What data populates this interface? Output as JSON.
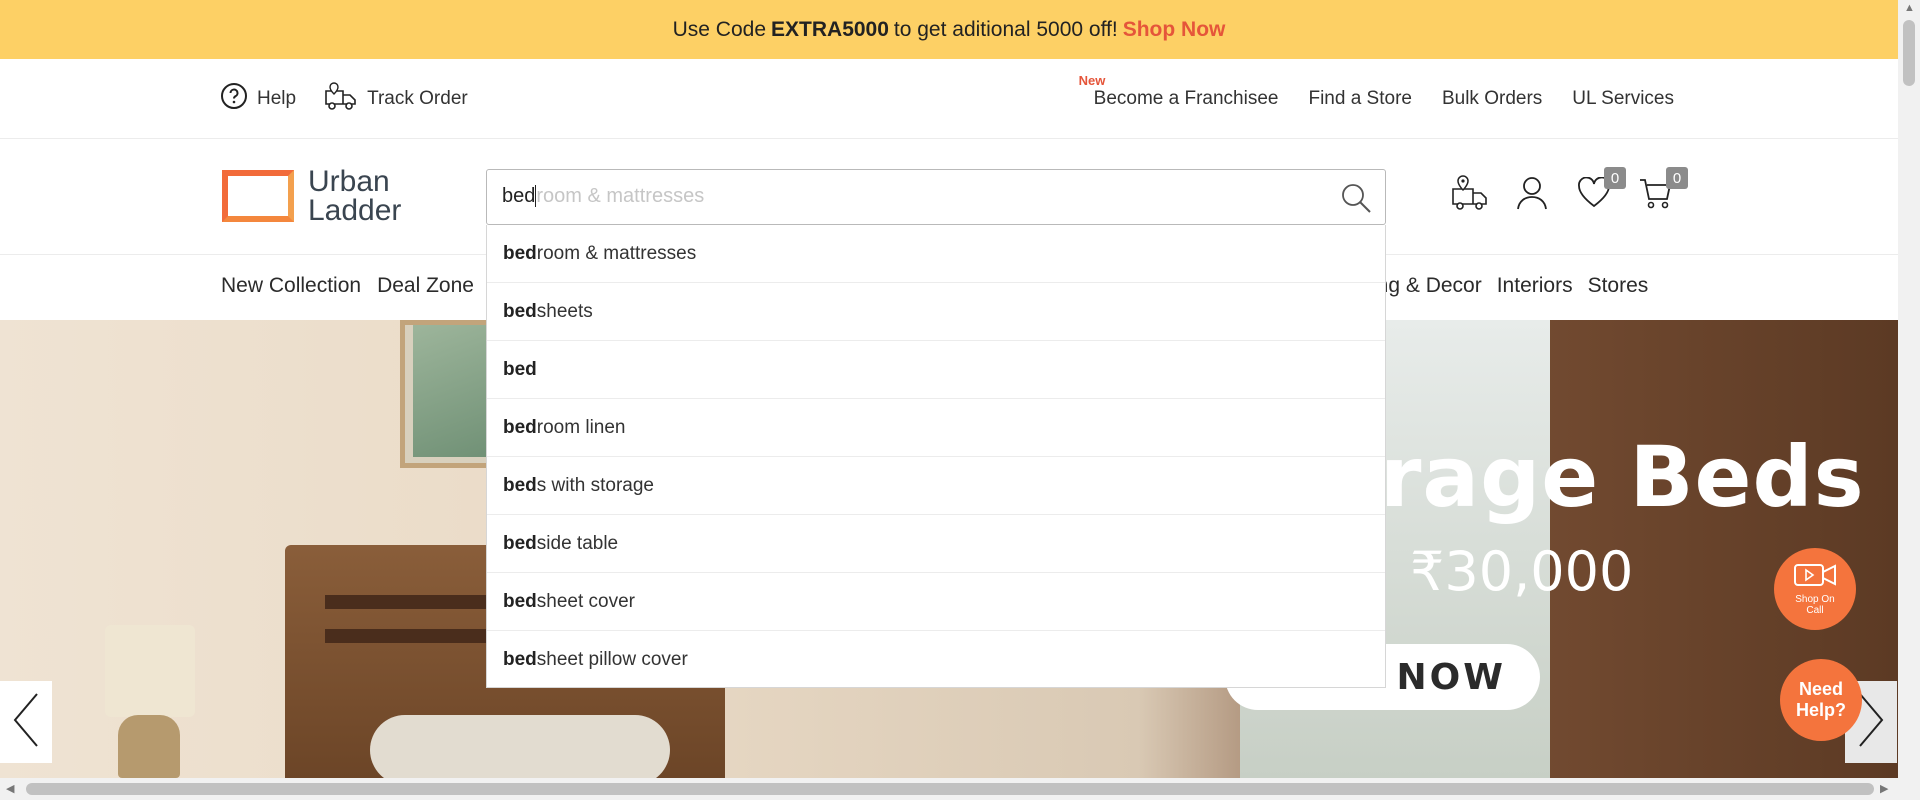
{
  "promo": {
    "prefix": "Use Code",
    "code": "EXTRA5000",
    "suffix": "to get aditional 5000 off!",
    "link": "Shop Now"
  },
  "utility": {
    "help": "Help",
    "track_order": "Track Order",
    "new_tag": "New",
    "franchise": "Become a Franchisee",
    "find_store": "Find a Store",
    "bulk_orders": "Bulk Orders",
    "ul_services": "UL Services"
  },
  "logo": {
    "line1": "Urban",
    "line2": "Ladder"
  },
  "search": {
    "typed": "bed",
    "ghost": "room & mattresses"
  },
  "header_icons": {
    "wishlist_count": "0",
    "cart_count": "0"
  },
  "nav": {
    "left": [
      "New Collection",
      "Deal Zone"
    ],
    "right": [
      "ing & Decor",
      "Interiors",
      "Stores"
    ]
  },
  "suggestions": [
    {
      "bold": "bed",
      "rest": "room & mattresses"
    },
    {
      "bold": "bed",
      "rest": "sheets"
    },
    {
      "bold": "bed",
      "rest": ""
    },
    {
      "bold": "bed",
      "rest": "room linen"
    },
    {
      "bold": "bed",
      "rest": "s with storage"
    },
    {
      "bold": "bed",
      "rest": "side table"
    },
    {
      "bold": "bed",
      "rest": "sheet cover"
    },
    {
      "bold": "bed",
      "rest": "sheet pillow cover"
    }
  ],
  "hero": {
    "headline": "rage Beds",
    "price": "₹30,000",
    "cta": "NOW"
  },
  "floating": {
    "shop_on_call": "Shop On Call",
    "need_help_1": "Need",
    "need_help_2": "Help?"
  },
  "colors": {
    "promo_bg": "#fdd065",
    "accent": "#e5553a",
    "floating_button": "#f4743d"
  }
}
